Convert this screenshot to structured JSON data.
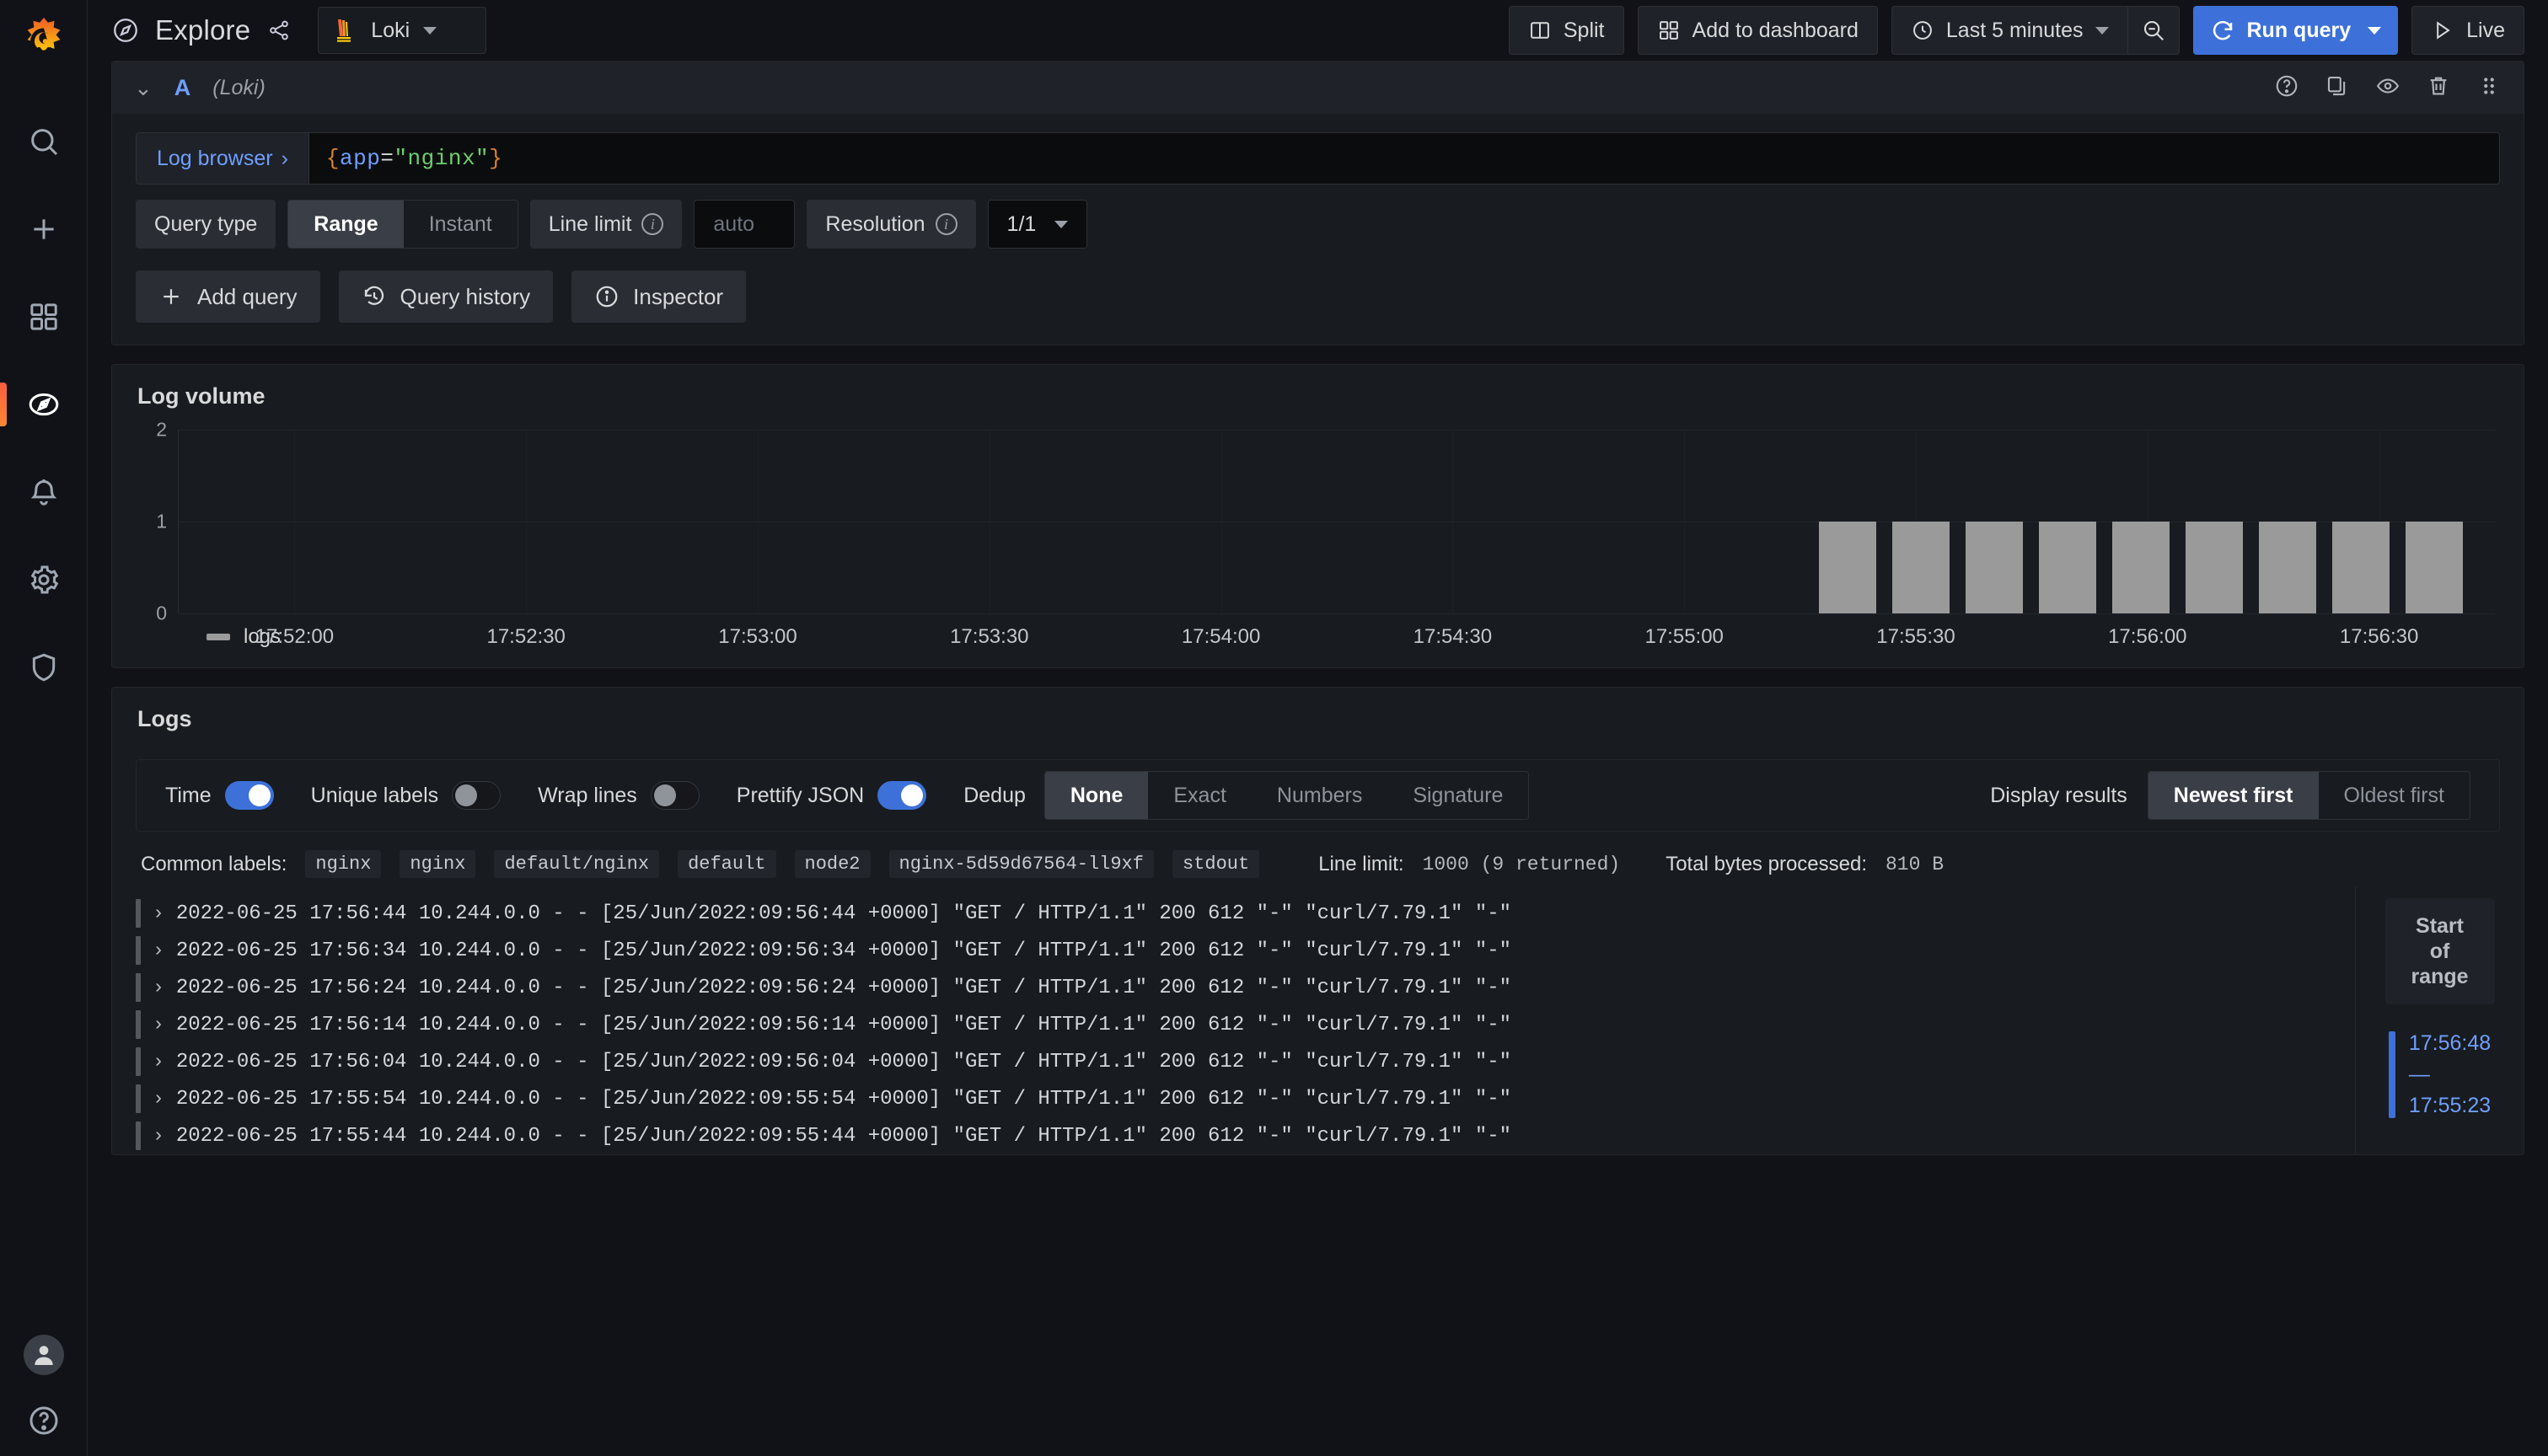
{
  "sidebar": {
    "logo_name": "grafana-logo",
    "items": [
      {
        "name": "search",
        "icon": "search-icon"
      },
      {
        "name": "create",
        "icon": "plus-icon"
      },
      {
        "name": "dashboards",
        "icon": "apps-grid-icon"
      },
      {
        "name": "explore",
        "icon": "compass-icon",
        "active": true
      },
      {
        "name": "alerting",
        "icon": "bell-icon"
      },
      {
        "name": "configuration",
        "icon": "gear-icon"
      },
      {
        "name": "server-admin",
        "icon": "shield-icon"
      }
    ],
    "avatar_label": "user-avatar",
    "help_label": "help-icon"
  },
  "topbar": {
    "title": "Explore",
    "share_label": "share-icon",
    "datasource": "Loki",
    "split_label": "Split",
    "add_to_dashboard_label": "Add to dashboard",
    "time_range": "Last 5 minutes",
    "zoom_out_label": "zoom-out",
    "run_query_label": "Run query",
    "live_label": "Live"
  },
  "query": {
    "ref_id": "A",
    "datasource_note": "(Loki)",
    "log_browser_label": "Log browser",
    "expr": {
      "open_brace": "{",
      "key": "app",
      "eq": "=",
      "value": "\"nginx\"",
      "close_brace": "}"
    },
    "query_type_label": "Query type",
    "query_type_options": [
      "Range",
      "Instant"
    ],
    "query_type_selected": "Range",
    "line_limit_label": "Line limit",
    "line_limit_placeholder": "auto",
    "line_limit_value": "",
    "resolution_label": "Resolution",
    "resolution_value": "1/1",
    "head_icons": [
      "help-circle-icon",
      "duplicate-icon",
      "eye-icon",
      "trash-icon",
      "drag-handle-icon"
    ]
  },
  "actions": {
    "add_query": "Add query",
    "query_history": "Query history",
    "inspector": "Inspector"
  },
  "chart_data": {
    "type": "bar",
    "title": "Log volume",
    "xlabel": "",
    "ylabel": "",
    "ylim": [
      0,
      2
    ],
    "yticks": [
      "0",
      "1",
      "2"
    ],
    "grid": true,
    "legend": [
      {
        "name": "logs",
        "color": "#9a9a9a"
      }
    ],
    "legend_position": "bottom-left",
    "xticks": [
      "17:52:00",
      "17:52:30",
      "17:53:00",
      "17:53:30",
      "17:54:00",
      "17:54:30",
      "17:55:00",
      "17:55:30",
      "17:56:00",
      "17:56:30"
    ],
    "categories": [
      "17:55:24",
      "17:55:34",
      "17:55:44",
      "17:55:54",
      "17:56:04",
      "17:56:14",
      "17:56:24",
      "17:56:34",
      "17:56:44"
    ],
    "values": [
      1,
      1,
      1,
      1,
      1,
      1,
      1,
      1,
      1
    ],
    "bar_color": "#9a9a9a"
  },
  "logs": {
    "panel_title": "Logs",
    "toggles": [
      {
        "label": "Time",
        "on": true
      },
      {
        "label": "Unique labels",
        "on": false
      },
      {
        "label": "Wrap lines",
        "on": false
      },
      {
        "label": "Prettify JSON",
        "on": true
      }
    ],
    "dedup_label": "Dedup",
    "dedup_options": [
      "None",
      "Exact",
      "Numbers",
      "Signature"
    ],
    "dedup_selected": "None",
    "display_label": "Display results",
    "display_options": [
      "Newest first",
      "Oldest first"
    ],
    "display_selected": "Newest first",
    "common_labels_title": "Common labels:",
    "common_labels": [
      "nginx",
      "nginx",
      "default/nginx",
      "default",
      "node2",
      "nginx-5d59d67564-ll9xf",
      "stdout"
    ],
    "line_limit_text_key": "Line limit:",
    "line_limit_text_value": "1000 (9 returned)",
    "bytes_key": "Total bytes processed:",
    "bytes_value": "810 B",
    "rows": [
      "2022-06-25 17:56:44 10.244.0.0 - - [25/Jun/2022:09:56:44 +0000] \"GET / HTTP/1.1\" 200 612 \"-\" \"curl/7.79.1\" \"-\"",
      "2022-06-25 17:56:34 10.244.0.0 - - [25/Jun/2022:09:56:34 +0000] \"GET / HTTP/1.1\" 200 612 \"-\" \"curl/7.79.1\" \"-\"",
      "2022-06-25 17:56:24 10.244.0.0 - - [25/Jun/2022:09:56:24 +0000] \"GET / HTTP/1.1\" 200 612 \"-\" \"curl/7.79.1\" \"-\"",
      "2022-06-25 17:56:14 10.244.0.0 - - [25/Jun/2022:09:56:14 +0000] \"GET / HTTP/1.1\" 200 612 \"-\" \"curl/7.79.1\" \"-\"",
      "2022-06-25 17:56:04 10.244.0.0 - - [25/Jun/2022:09:56:04 +0000] \"GET / HTTP/1.1\" 200 612 \"-\" \"curl/7.79.1\" \"-\"",
      "2022-06-25 17:55:54 10.244.0.0 - - [25/Jun/2022:09:55:54 +0000] \"GET / HTTP/1.1\" 200 612 \"-\" \"curl/7.79.1\" \"-\"",
      "2022-06-25 17:55:44 10.244.0.0 - - [25/Jun/2022:09:55:44 +0000] \"GET / HTTP/1.1\" 200 612 \"-\" \"curl/7.79.1\" \"-\""
    ],
    "nav": {
      "start_of_range": "Start\nof\nrange",
      "start_of_range_l1": "Start",
      "start_of_range_l2": "of",
      "start_of_range_l3": "range",
      "time_top": "17:56:48",
      "time_dash": "—",
      "time_bottom": "17:55:23"
    }
  },
  "colors": {
    "accent_blue": "#3d71d9",
    "link_blue": "#6e9fff",
    "bar_gray": "#9a9a9a",
    "panel_bg": "#181b1f",
    "page_bg": "#111217",
    "orange": "#f55f3e"
  }
}
